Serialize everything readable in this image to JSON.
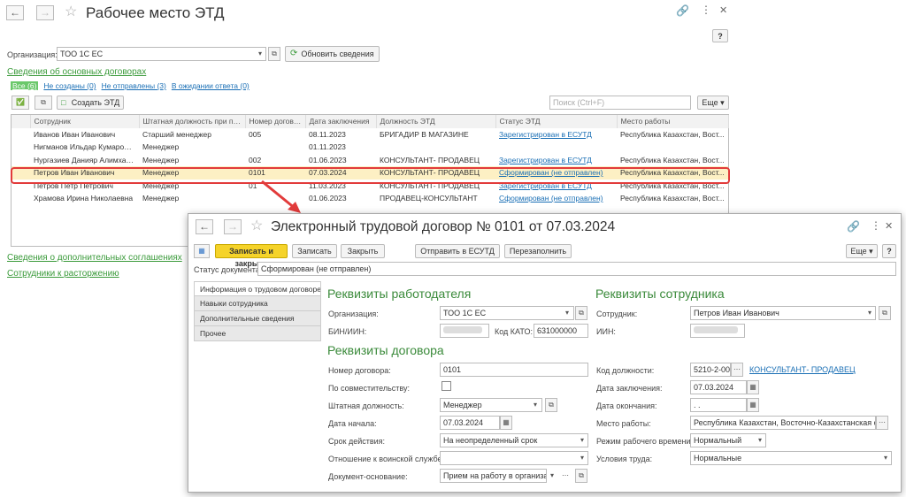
{
  "main": {
    "title": "Рабочее место ЭТД",
    "org_label": "Организация:",
    "org_value": "ТОО 1С ЕС",
    "refresh_label": "Обновить сведения",
    "main_contracts_link": "Сведения об основных договорах",
    "filters": [
      "Все (6)",
      "Не созданы (0)",
      "Не отправлены (3)",
      "В ожидании ответа (0)"
    ],
    "create_etd_label": "Создать ЭТД",
    "search_placeholder": "Поиск (Ctrl+F)",
    "more_label": "Еще",
    "columns": [
      "Сотрудник",
      "Штатная должность при пр...",
      "Номер догово...",
      "Дата заключения",
      "Должность ЭТД",
      "Статус ЭТД",
      "Место работы"
    ],
    "rows": [
      [
        "Иванов Иван Иванович",
        "Старший менеджер",
        "005",
        "08.11.2023",
        "БРИГАДИР В МАГАЗИНЕ",
        "Зарегистрирован в ЕСУТД",
        "Республика Казахстан, Вост..."
      ],
      [
        "Нигманов Ильдар Кумарович",
        "Менеджер",
        "",
        "01.11.2023",
        "",
        "",
        ""
      ],
      [
        "Нургазиев Данияр Алимхан...",
        "Менеджер",
        "002",
        "01.06.2023",
        "КОНСУЛЬТАНТ- ПРОДАВЕЦ",
        "Зарегистрирован в ЕСУТД",
        "Республика Казахстан, Вост..."
      ],
      [
        "Петров Иван Иванович",
        "Менеджер",
        "0101",
        "07.03.2024",
        "КОНСУЛЬТАНТ- ПРОДАВЕЦ",
        "Сформирован (не отправлен)",
        "Республика Казахстан, Вост..."
      ],
      [
        "Петров Петр Петрович",
        "Менеджер",
        "01",
        "11.03.2023",
        "КОНСУЛЬТАНТ- ПРОДАВЕЦ",
        "Зарегистрирован в ЕСУТД",
        "Республика Казахстан, Вост..."
      ],
      [
        "Храмова Ирина Николаевна",
        "Менеджер",
        "",
        "01.06.2023",
        "ПРОДАВЕЦ-КОНСУЛЬТАНТ",
        "Сформирован (не отправлен)",
        "Республика Казахстан, Вост..."
      ]
    ],
    "selected_row": 3,
    "additional_link": "Сведения о дополнительных соглашениях",
    "dismissal_link": "Сотрудники к расторжению"
  },
  "dialog": {
    "title": "Электронный трудовой договор № 0101 от 07.03.2024",
    "save_close": "Записать и закрыть",
    "save": "Записать",
    "close": "Закрыть",
    "send": "Отправить в ЕСУТД",
    "refill": "Перезаполнить",
    "more": "Еще",
    "status_label": "Статус документа:",
    "status_value": "Сформирован (не отправлен)",
    "tabs": [
      "Информация о трудовом договоре",
      "Навыки сотрудника",
      "Дополнительные сведения",
      "Прочее"
    ],
    "employer_header": "Реквизиты работодателя",
    "employee_header": "Реквизиты сотрудника",
    "contract_header": "Реквизиты договора",
    "org_label": "Организация:",
    "org_value": "ТОО 1С ЕС",
    "bin_label": "БИН/ИИН:",
    "kato_label": "Код КАТО:",
    "kato_value": "631000000",
    "employee_label": "Сотрудник:",
    "employee_value": "Петров Иван Иванович",
    "iin_label": "ИИН:",
    "number_label": "Номер договора:",
    "number_value": "0101",
    "parttime_label": "По совместительству:",
    "position_label": "Штатная должность:",
    "position_value": "Менеджер",
    "start_label": "Дата начала:",
    "start_value": "07.03.2024",
    "term_label": "Срок действия:",
    "term_value": "На неопределенный срок",
    "military_label": "Отношение к воинской службе:",
    "military_value": "",
    "basis_label": "Документ-основание:",
    "basis_value": "Прием на работу в организац...",
    "poscode_label": "Код должности:",
    "poscode_value": "5210-2-00'",
    "poscode_link": "КОНСУЛЬТАНТ- ПРОДАВЕЦ",
    "conclusion_label": "Дата заключения:",
    "conclusion_value": "07.03.2024",
    "end_label": "Дата окончания:",
    "end_value": " .  .",
    "workplace_label": "Место работы:",
    "workplace_value": "Республика Казахстан, Восточно-Казахстанская обл",
    "mode_label": "Режим рабочего времени:",
    "mode_value": "Нормальный",
    "conditions_label": "Условия труда:",
    "conditions_value": "Нормальные"
  }
}
